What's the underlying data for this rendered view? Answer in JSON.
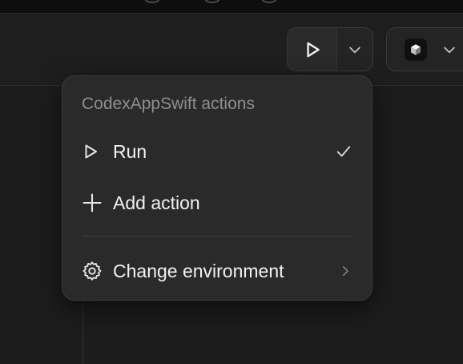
{
  "toolbar": {
    "run_icon": "play-icon",
    "caret_icon": "chevron-down-icon",
    "env_icon": "cube-icon"
  },
  "menu": {
    "header": "CodexAppSwift actions",
    "items": [
      {
        "label": "Run",
        "icon": "play-icon",
        "trailing": "checkmark-icon",
        "selected": true
      },
      {
        "label": "Add action",
        "icon": "plus-icon"
      },
      {
        "label": "Change environment",
        "icon": "gear-icon",
        "trailing": "chevron-right-icon"
      }
    ]
  },
  "colors": {
    "background": "#1c1c1c",
    "menu_bg": "#2a2a2a",
    "text": "#f2f2f2",
    "muted": "#8e8e8e"
  }
}
